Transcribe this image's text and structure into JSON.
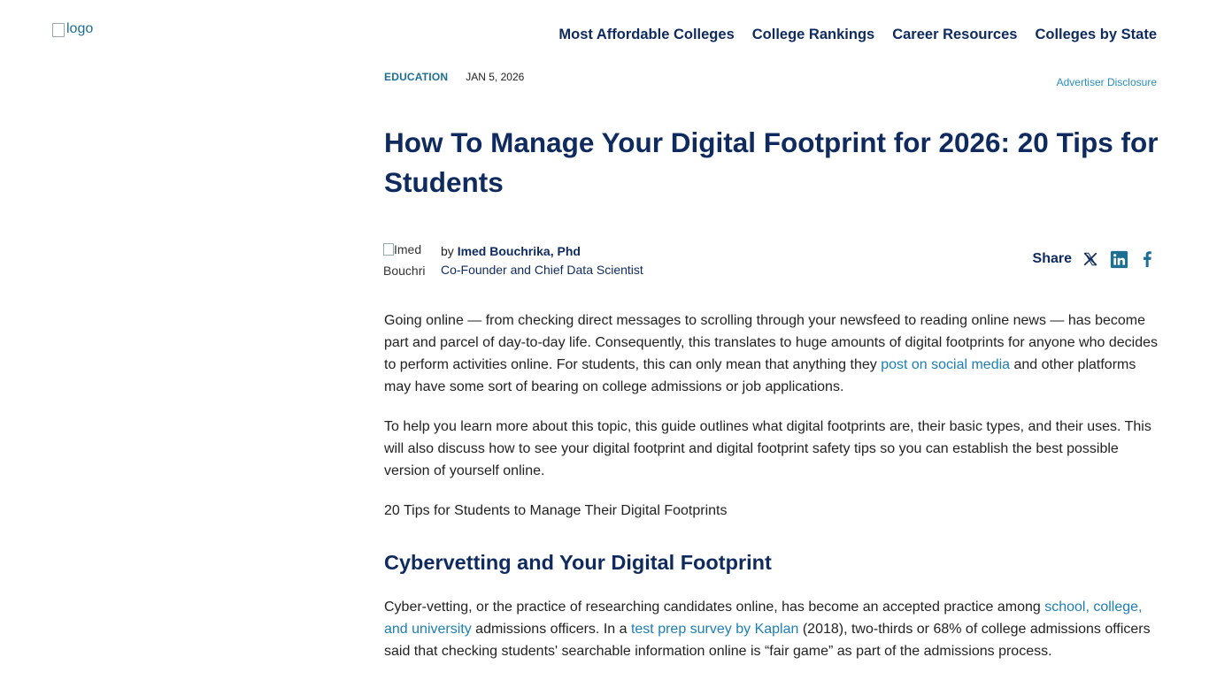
{
  "header": {
    "logo_alt": "logo",
    "nav": [
      "Most Affordable Colleges",
      "College Rankings",
      "Career Resources",
      "Colleges by State"
    ]
  },
  "meta": {
    "category": "EDUCATION",
    "date": "JAN 5, 2026",
    "disclosure": "Advertiser Disclosure"
  },
  "article": {
    "title": "How To Manage Your Digital Footprint for 2026: 20 Tips for Students",
    "author": {
      "img_alt_line1": "Imed",
      "img_alt_line2": "Bouchri",
      "by": "by",
      "name": "Imed Bouchrika, Phd",
      "role": "Co-Founder and Chief Data Scientist"
    },
    "share_label": "Share",
    "share_icons": [
      "x-icon",
      "linkedin-icon",
      "facebook-icon"
    ],
    "p1_a": "Going online — from checking direct messages to scrolling through your newsfeed to reading online news — has become part and parcel of day-to-day life. Consequently, this translates to huge amounts of digital footprints for anyone who decides to perform activities online. For students, this can only mean that anything they ",
    "p1_link": "post on social media",
    "p1_b": " and other platforms may have some sort of bearing on college admissions or job applications.",
    "p2": "To help you learn more about this topic, this guide outlines what digital footprints are, their basic types, and their uses. This will also discuss how to see your digital footprint and digital footprint safety tips so you can establish the best possible version of yourself online.",
    "toc": "20 Tips for Students to Manage Their Digital Footprints",
    "h2": "Cybervetting and Your Digital Footprint",
    "p3_a": "Cyber-vetting, or the practice of researching candidates online, has become an accepted practice among ",
    "p3_link1": "school, college, and university",
    "p3_b": " admissions officers. In a ",
    "p3_link2": "test prep survey by Kaplan",
    "p3_c": " (2018), two-thirds or 68% of college admissions officers said that checking students' searchable information online is “fair game” as part of the admissions process."
  },
  "colors": {
    "navy": "#0e2a5e",
    "link": "#1c7fb3",
    "category": "#1c6f93"
  }
}
